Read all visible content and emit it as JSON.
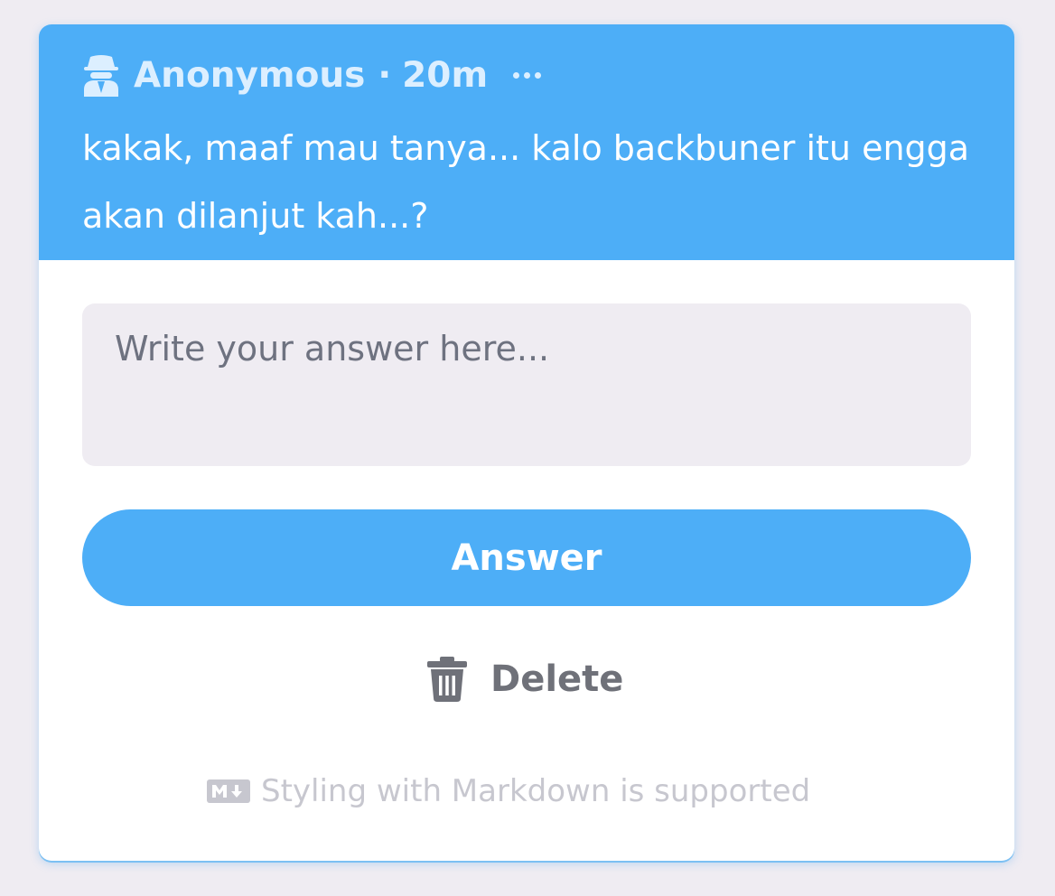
{
  "question_card": {
    "author": "Anonymous",
    "separator": "·",
    "time_ago": "20m",
    "author_icon": "spy-icon",
    "more_icon": "more-horizontal-icon",
    "question_text": "kakak, maaf mau tanya... kalo backbuner itu engga akan dilanjut kah...?"
  },
  "answer_form": {
    "placeholder": "Write your answer here...",
    "value": "",
    "answer_label": "Answer",
    "delete_label": "Delete",
    "delete_icon": "trash-icon",
    "markdown_icon": "markdown-icon",
    "markdown_note": "Styling with Markdown is supported"
  },
  "colors": {
    "accent": "#4daef7",
    "background": "#efecf2",
    "card": "#ffffff",
    "muted_text": "#6f7179",
    "faint_text": "#c7c7cf"
  }
}
